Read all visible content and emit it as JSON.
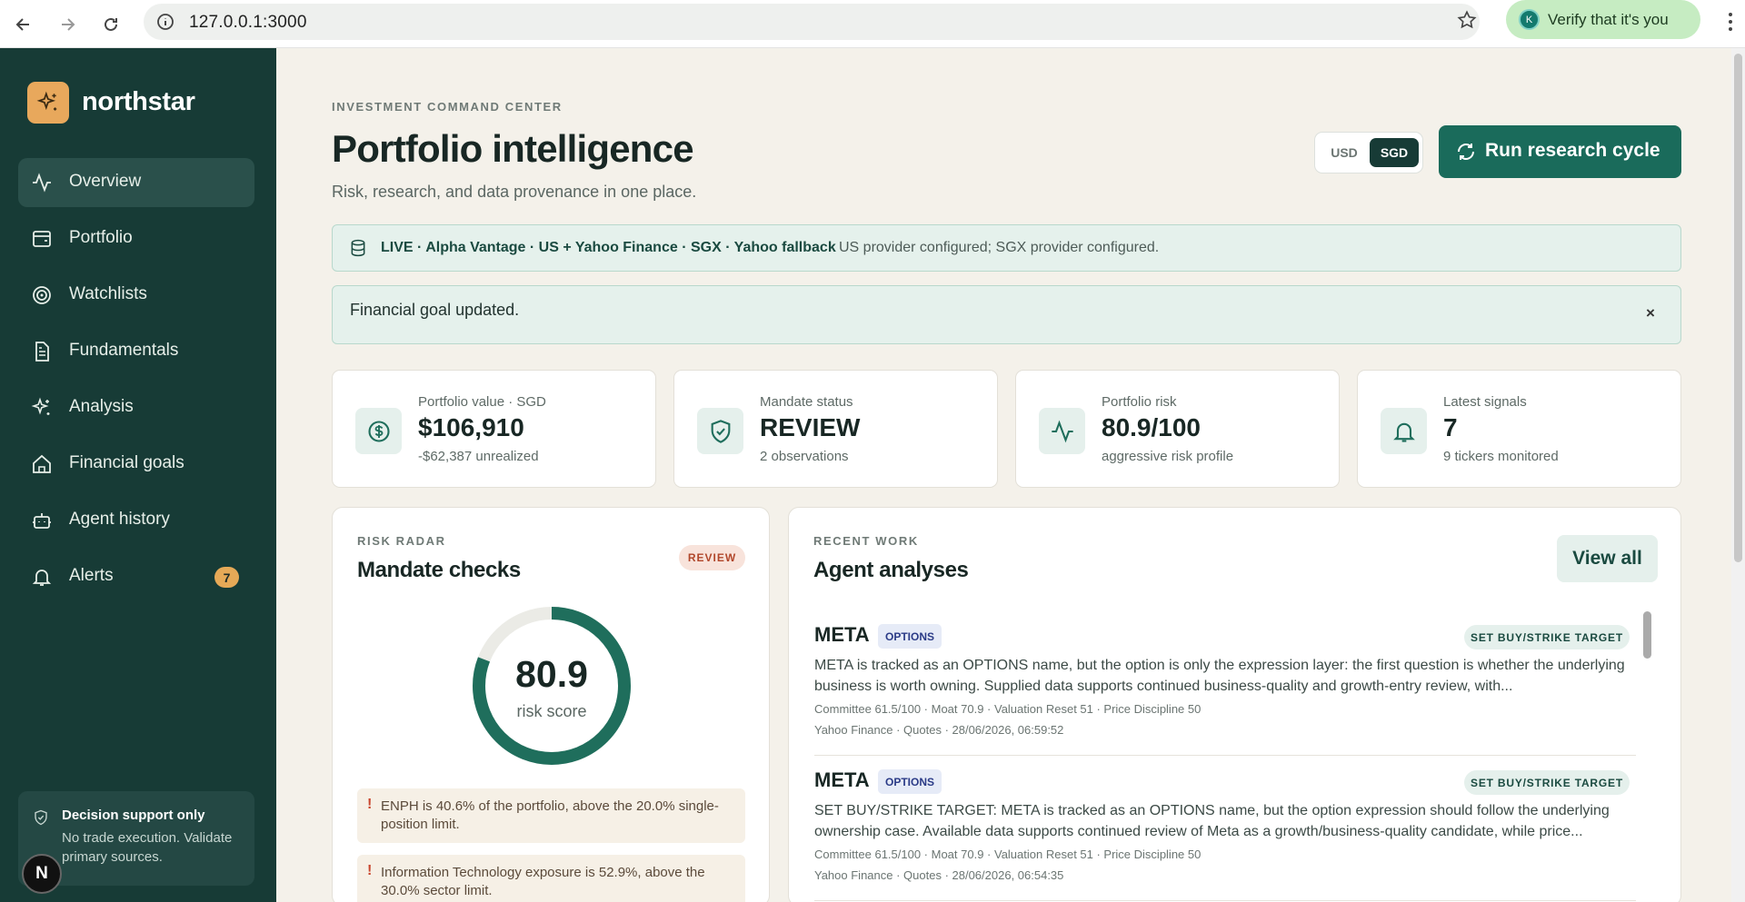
{
  "browser": {
    "url": "127.0.0.1:3000",
    "verify_label": "Verify that it's you",
    "profile_initial": "K"
  },
  "sidebar": {
    "brand": "northstar",
    "items": [
      {
        "label": "Overview",
        "icon": "activity-icon"
      },
      {
        "label": "Portfolio",
        "icon": "wallet-icon"
      },
      {
        "label": "Watchlists",
        "icon": "target-icon"
      },
      {
        "label": "Fundamentals",
        "icon": "document-icon"
      },
      {
        "label": "Analysis",
        "icon": "sparkle-icon"
      },
      {
        "label": "Financial goals",
        "icon": "home-icon"
      },
      {
        "label": "Agent history",
        "icon": "bot-icon"
      },
      {
        "label": "Alerts",
        "icon": "bell-icon",
        "badge": "7"
      }
    ],
    "decision": {
      "title": "Decision support only",
      "text": "No trade execution. Validate primary sources."
    },
    "avatar": "N"
  },
  "header": {
    "eyebrow": "INVESTMENT COMMAND CENTER",
    "title": "Portfolio intelligence",
    "subtitle": "Risk, research, and data provenance in one place.",
    "currency_usd": "USD",
    "currency_sgd": "SGD",
    "selected_currency": "SGD",
    "run_button": "Run research cycle"
  },
  "live_banner": {
    "bold": "LIVE · Alpha Vantage · US + Yahoo Finance · SGX · Yahoo fallback",
    "text": "US provider configured; SGX provider configured."
  },
  "toast": {
    "message": "Financial goal updated.",
    "close": "×"
  },
  "stats": [
    {
      "label": "Portfolio value · SGD",
      "value": "$106,910",
      "sub": "-$62,387 unrealized",
      "icon": "dollar-circle-icon"
    },
    {
      "label": "Mandate status",
      "value": "REVIEW",
      "sub": "2 observations",
      "icon": "shield-icon"
    },
    {
      "label": "Portfolio risk",
      "value": "80.9/100",
      "sub": "aggressive risk profile",
      "icon": "pulse-icon"
    },
    {
      "label": "Latest signals",
      "value": "7",
      "sub": "9 tickers monitored",
      "icon": "bell-icon"
    }
  ],
  "risk_radar": {
    "eyebrow": "RISK RADAR",
    "title": "Mandate checks",
    "badge": "REVIEW",
    "score": "80.9",
    "score_fraction": 0.809,
    "score_label": "risk score",
    "observations": [
      {
        "mark": "!",
        "text": "ENPH is 40.6% of the portfolio, above the 20.0% single-position limit."
      },
      {
        "mark": "!",
        "text": "Information Technology exposure is 52.9%, above the 30.0% sector limit."
      }
    ]
  },
  "recent_work": {
    "eyebrow": "RECENT WORK",
    "title": "Agent analyses",
    "view_all": "View all",
    "analyses": [
      {
        "ticker": "META",
        "tag": "OPTIONS",
        "action": "SET BUY/STRIKE TARGET",
        "description": "META is tracked as an OPTIONS name, but the option is only the expression layer: the first question is whether the underlying business is worth owning. Supplied data supports continued business-quality and growth-entry review, with...",
        "metrics": "Committee 61.5/100 · Moat 70.9 · Valuation Reset 51 · Price Discipline 50",
        "source": "Yahoo Finance · Quotes · 28/06/2026, 06:59:52"
      },
      {
        "ticker": "META",
        "tag": "OPTIONS",
        "action": "SET BUY/STRIKE TARGET",
        "description": "SET BUY/STRIKE TARGET: META is tracked as an OPTIONS name, but the option expression should follow the underlying ownership case. Available data supports continued review of Meta as a growth/business-quality candidate, while price...",
        "metrics": "Committee 61.5/100 · Moat 70.9 · Valuation Reset 51 · Price Discipline 50",
        "source": "Yahoo Finance · Quotes · 28/06/2026, 06:54:35"
      }
    ]
  },
  "colors": {
    "sidebar": "#173b36",
    "accent": "#1a6b5b",
    "brand_logo": "#e8a85c",
    "gauge": "#1f6e5c",
    "review": "#b1472b"
  }
}
